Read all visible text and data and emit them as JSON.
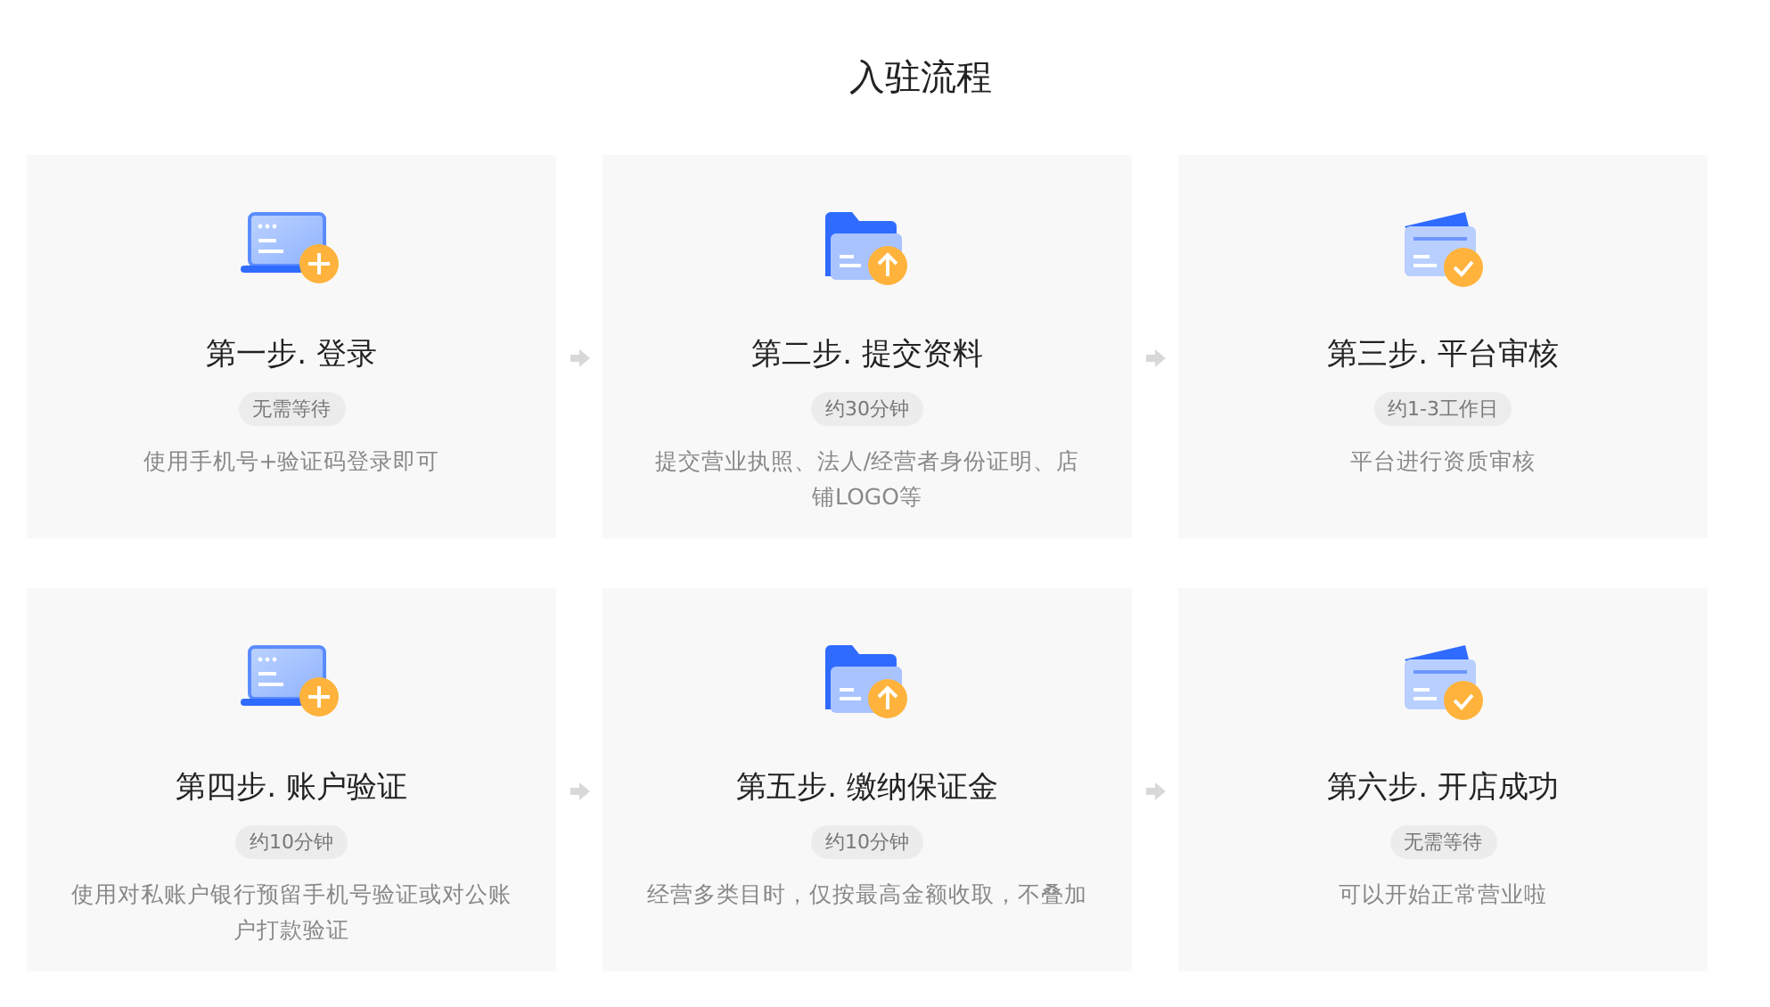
{
  "title": "入驻流程",
  "steps": [
    {
      "kind": "laptop",
      "title": "第一步. 登录",
      "badge": "无需等待",
      "description": "使用手机号+验证码登录即可"
    },
    {
      "kind": "folder",
      "title": "第二步. 提交资料",
      "badge": "约30分钟",
      "description": "提交营业执照、法人/经营者身份证明、店铺LOGO等"
    },
    {
      "kind": "card",
      "title": "第三步. 平台审核",
      "badge": "约1-3工作日",
      "description": "平台进行资质审核"
    },
    {
      "kind": "laptop",
      "title": "第四步. 账户验证",
      "badge": "约10分钟",
      "description": "使用对私账户银行预留手机号验证或对公账户打款验证"
    },
    {
      "kind": "folder",
      "title": "第五步. 缴纳保证金",
      "badge": "约10分钟",
      "description": "经营多类目时，仅按最高金额收取，不叠加"
    },
    {
      "kind": "card",
      "title": "第六步. 开店成功",
      "badge": "无需等待",
      "description": "可以开始正常营业啦"
    }
  ]
}
